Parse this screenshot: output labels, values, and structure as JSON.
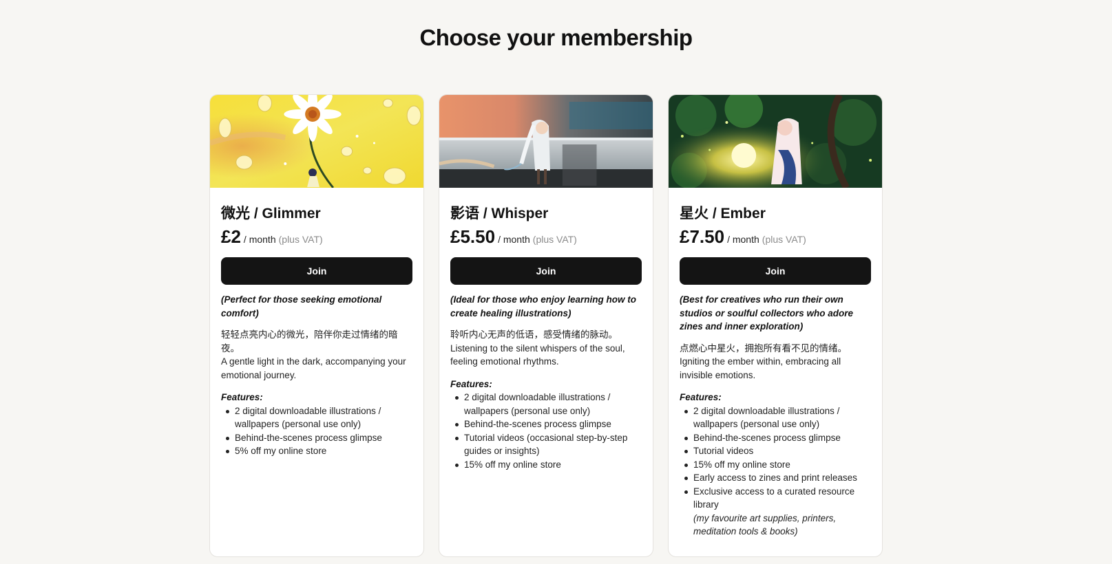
{
  "page": {
    "title": "Choose your membership"
  },
  "tiers": [
    {
      "name": "微光 / Glimmer",
      "price": "£2",
      "period": "/ month",
      "vat_note": "(plus VAT)",
      "join_label": "Join",
      "tagline": "(Perfect for those seeking emotional comfort)",
      "desc_cn": "轻轻点亮内心的微光，陪伴你走过情绪的暗夜。",
      "desc_en": "A gentle light in the dark, accompanying your emotional journey.",
      "features_label": "Features:",
      "features": [
        "2 digital downloadable illustrations / wallpapers (personal use only)",
        "Behind-the-scenes process glimpse",
        "5% off my online store"
      ],
      "image": "daisy-yellow-illustration"
    },
    {
      "name": "影语 / Whisper",
      "price": "£5.50",
      "period": "/ month",
      "vat_note": "(plus VAT)",
      "join_label": "Join",
      "tagline": "(Ideal for those who enjoy learning how to create healing illustrations)",
      "desc_cn": "聆听内心无声的低语，感受情绪的脉动。",
      "desc_en": "Listening to the silent whispers of the soul, feeling emotional rhythms.",
      "features_label": "Features:",
      "features": [
        "2 digital downloadable illustrations / wallpapers (personal use only)",
        "Behind-the-scenes process glimpse",
        "Tutorial videos (occasional step-by-step guides or insights)",
        "15% off my online store"
      ],
      "image": "girl-shadow-wall-illustration"
    },
    {
      "name": "星火 / Ember",
      "price": "£7.50",
      "period": "/ month",
      "vat_note": "(plus VAT)",
      "join_label": "Join",
      "tagline": "(Best for creatives who run their own studios or soulful collectors who adore zines and inner exploration)",
      "desc_cn": "点燃心中星火，拥抱所有看不见的情绪。",
      "desc_en": "Igniting the ember within, embracing all invisible emotions.",
      "features_label": "Features:",
      "features": [
        "2 digital downloadable illustrations / wallpapers (personal use only)",
        "Behind-the-scenes process glimpse",
        "Tutorial videos",
        "15% off my online store",
        "Early access to zines and print releases",
        "Exclusive access to a curated resource library"
      ],
      "feature_note": "(my favourite art supplies, printers, meditation tools & books)",
      "image": "girl-forest-glow-illustration"
    }
  ],
  "colors": {
    "background": "#f7f6f3",
    "button": "#141414",
    "button_text": "#ffffff",
    "muted": "#8a8a8a"
  }
}
